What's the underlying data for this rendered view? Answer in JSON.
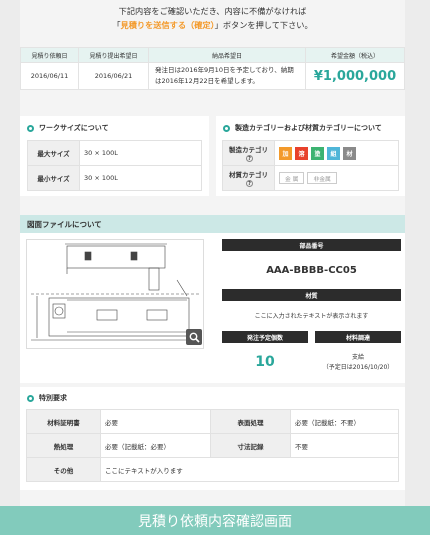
{
  "intro": {
    "line1": "下記内容をご確認いただき、内容に不備がなければ",
    "line2_pre": "「",
    "line2_hl": "見積りを送信する（確定）",
    "line2_post": "」ボタンを押して下さい。"
  },
  "summary": {
    "headers": [
      "見積り依頼日",
      "見積り提出希望日",
      "納品希望日",
      "希望金額（税込）"
    ],
    "request_date": "2016/06/11",
    "submit_date": "2016/06/21",
    "delivery_note": "発注日は2016年9月10日を予定しており、納期は2016年12月22日を希望します。",
    "price": "¥1,000,000"
  },
  "work_size": {
    "title": "ワークサイズについて",
    "rows": [
      {
        "label": "最大サイズ",
        "value": "30 × 100L"
      },
      {
        "label": "最小サイズ",
        "value": "30 × 100L"
      }
    ]
  },
  "category": {
    "title": "製造カテゴリーおよび材質カテゴリーについて",
    "mfg_label": "製造カテゴリ",
    "mfg_tags": [
      {
        "text": "加",
        "color": "#f39a2b"
      },
      {
        "text": "溶",
        "color": "#e8412c"
      },
      {
        "text": "塗",
        "color": "#3cb371"
      },
      {
        "text": "組",
        "color": "#4fb6d8"
      },
      {
        "text": "材",
        "color": "#8a8a8a"
      }
    ],
    "mat_label": "材質カテゴリ",
    "mat_tags": [
      "金 属",
      "非金属"
    ],
    "help": "?"
  },
  "drawing": {
    "title": "図面ファイルについて",
    "part_no_label": "部品番号",
    "part_no": "AAA-BBBB-CC05",
    "material_label": "材質",
    "material_text": "ここに入力されたテキストが表示されます",
    "qty_label": "発注予定個数",
    "qty": "10",
    "supply_label": "材料調達",
    "supply_value": "支給",
    "supply_note": "（予定日は2016/10/20）",
    "zoom_icon": "magnify-icon"
  },
  "special": {
    "title": "特別要求",
    "rows": [
      {
        "k1": "材料証明書",
        "v1": "必要",
        "k2": "表面処理",
        "v2": "必要（記載紙：不要）"
      },
      {
        "k1": "熱処理",
        "v1": "必要（記載紙：必要）",
        "k2": "寸法記録",
        "v2": "不要"
      }
    ],
    "other_label": "その他",
    "other_value": "ここにテキストが入ります"
  },
  "footer": "見積り依頼内容確認画面"
}
